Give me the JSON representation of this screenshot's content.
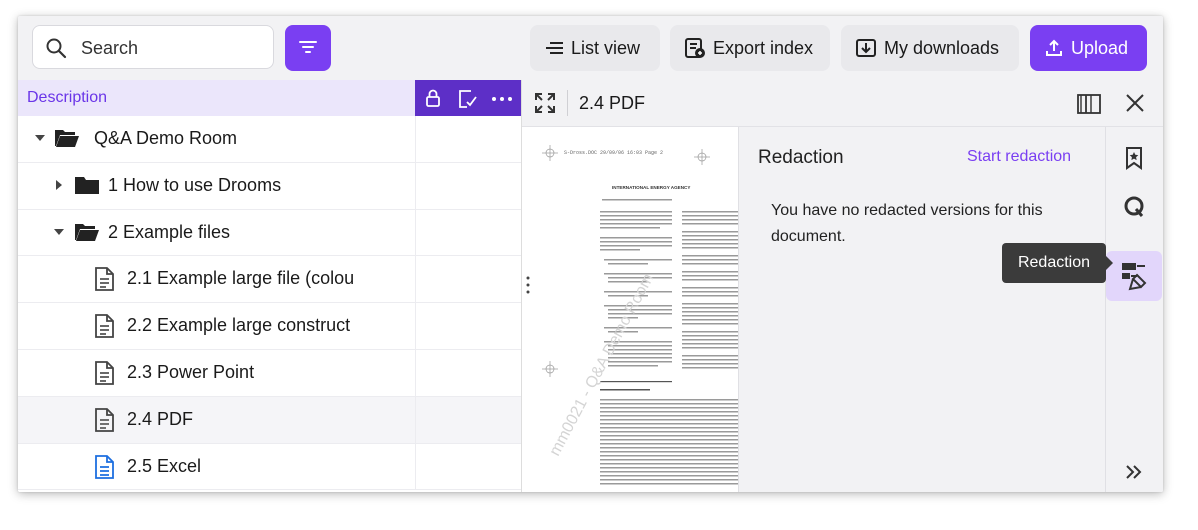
{
  "topbar": {
    "search_placeholder": "Search",
    "list_view": "List view",
    "export_index": "Export index",
    "my_downloads": "My downloads",
    "upload": "Upload",
    "accent": "#7a3ff2"
  },
  "tree": {
    "column_header": "Description",
    "rows": [
      {
        "label": "Q&A Demo Room",
        "type": "folder-open",
        "caret": "down"
      },
      {
        "label": "1 How to use Drooms",
        "type": "folder",
        "caret": "right"
      },
      {
        "label": "2 Example files",
        "type": "folder-open",
        "caret": "down"
      },
      {
        "label": "2.1 Example large file (colou",
        "type": "doc"
      },
      {
        "label": "2.2 Example large construct",
        "type": "doc"
      },
      {
        "label": "2.3 Power Point",
        "type": "doc"
      },
      {
        "label": "2.4 PDF",
        "type": "doc",
        "selected": true
      },
      {
        "label": "2.5 Excel",
        "type": "doc-blue"
      }
    ]
  },
  "viewer": {
    "file_name": "2.4 PDF"
  },
  "redaction": {
    "title": "Redaction",
    "start_label": "Start redaction",
    "message": "You have no redacted versions for this document.",
    "tooltip": "Redaction"
  },
  "document_preview": {
    "header_line": "S-Dross.DOC  29/09/06  16:03  Page 2",
    "org_name": "INTERNATIONAL ENERGY AGENCY",
    "watermark": "mm0021 - Q&A Demo Room"
  }
}
